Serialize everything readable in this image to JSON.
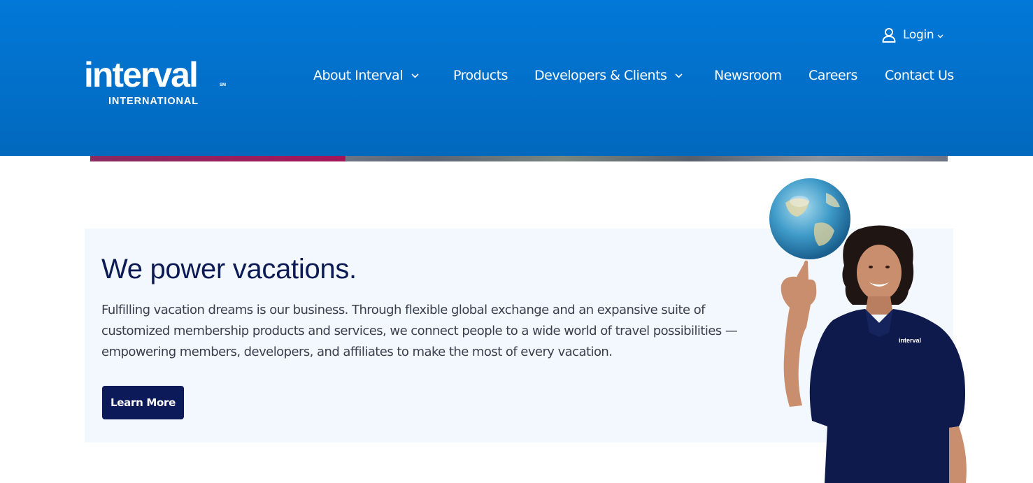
{
  "header": {
    "logo": {
      "wordmark": "interval",
      "service_mark": "SM",
      "subtitle": "INTERNATIONAL"
    },
    "login": {
      "label": "Login"
    },
    "nav": [
      {
        "label": "About Interval",
        "has_dropdown": true
      },
      {
        "label": "Products",
        "has_dropdown": false
      },
      {
        "label": "Developers & Clients",
        "has_dropdown": true
      },
      {
        "label": "Newsroom",
        "has_dropdown": false
      },
      {
        "label": "Careers",
        "has_dropdown": false
      },
      {
        "label": "Contact Us",
        "has_dropdown": false
      }
    ]
  },
  "hero": {
    "title": "We power vacations.",
    "description": "Fulfilling vacation dreams is our business. Through flexible global exchange and an expansive suite of customized membership products and services, we connect people to a wide world of travel possibilities — empowering members, developers, and affiliates to make the most of every vacation.",
    "cta_label": "Learn More",
    "image": {
      "shirt_logo_text": "interval"
    }
  },
  "icons": [
    "user-icon",
    "chevron-down-icon"
  ],
  "colors": {
    "header_blue": "#0274d4",
    "navy": "#0c1a5a",
    "panel_bg": "#f3f7fe",
    "body_text": "#3a3f4c"
  }
}
